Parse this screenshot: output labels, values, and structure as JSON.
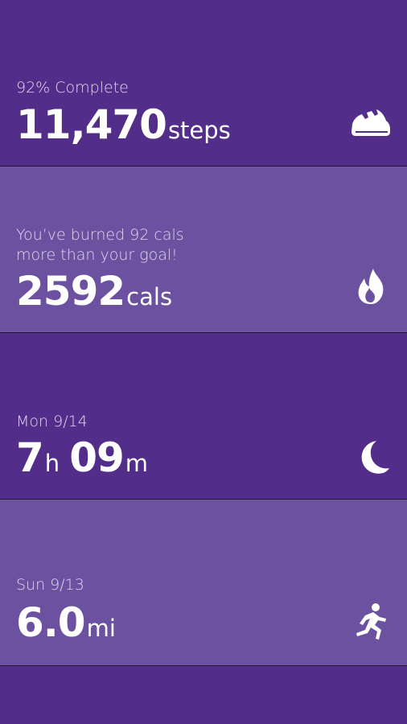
{
  "tiles": [
    {
      "subtitle_line1": "92% Complete",
      "value": "11,470",
      "unit": "steps",
      "icon": "shoe-icon"
    },
    {
      "subtitle_line1": "You’ve burned 92 cals",
      "subtitle_line2": "more than your goal!",
      "value": "2592",
      "unit": "cals",
      "icon": "flame-icon"
    },
    {
      "subtitle_line1": "Mon 9/14",
      "value_hours": "7",
      "unit_hours": "h",
      "value_minutes": "09",
      "unit_minutes": "m",
      "icon": "moon-icon"
    },
    {
      "subtitle_line1": "Sun 9/13",
      "value": "6.0",
      "unit": "mi",
      "icon": "runner-icon"
    }
  ],
  "colors": {
    "dark_tile": "#522d8a",
    "light_tile": "#6b51a0",
    "text": "#ffffff",
    "subtitle_text": "#e0d6ef"
  }
}
